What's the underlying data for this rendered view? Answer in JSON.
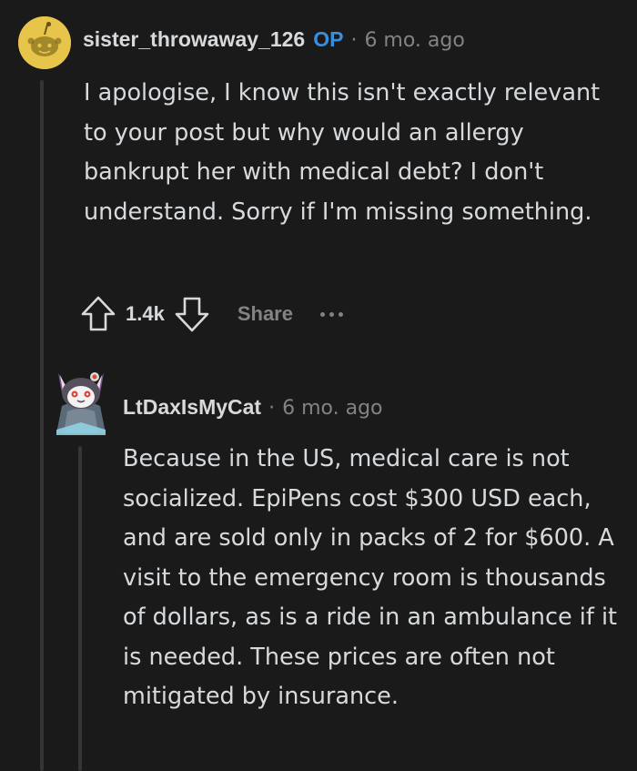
{
  "comment1": {
    "username": "sister_throwaway_126",
    "op_badge": "OP",
    "separator": "·",
    "time": "6 mo. ago",
    "body": "I apologise, I know this isn't exactly relevant to your post but why would an allergy bankrupt her with medical debt? I don't understand. Sorry if I'm missing something.",
    "avatar_icon": "snoo-avatar-icon",
    "avatar_bg": "#e7c54a",
    "op_color": "#3a8fdd"
  },
  "actions": {
    "score": "1.4k",
    "share_label": "Share",
    "upvote_icon": "upvote-arrow-icon",
    "downvote_icon": "downvote-arrow-icon",
    "more_icon": "more-dots-icon"
  },
  "comment2": {
    "username": "LtDaxIsMyCat",
    "separator": "·",
    "time": "6 mo. ago",
    "body": "Because in the US, medical care is not socialized. EpiPens cost $300 USD each, and are sold only in packs of 2 for $600. A visit to the emergency room is thousands of dollars, as is a ride in an ambulance if it is needed. These prices are often not mitigated by insurance.",
    "avatar_icon": "cat-avatar-icon"
  }
}
